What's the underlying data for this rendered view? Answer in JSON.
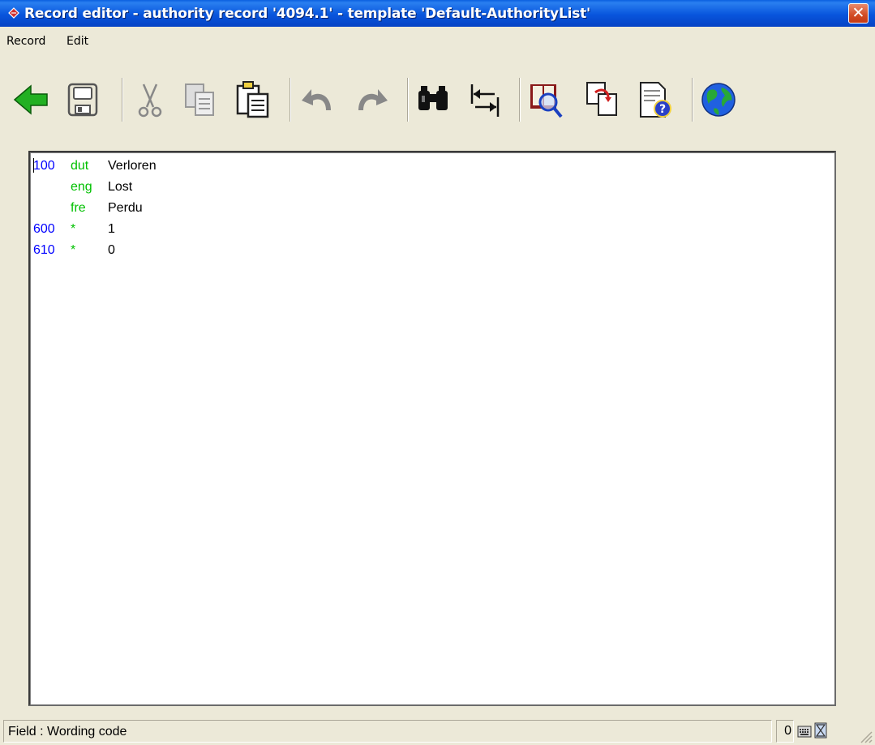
{
  "window": {
    "title": "Record editor - authority record '4094.1' - template 'Default-AuthorityList'",
    "close_glyph": "✕"
  },
  "menu": [
    {
      "label": "Record"
    },
    {
      "label": "Edit"
    }
  ],
  "toolbar": [
    {
      "icon": "back-arrow-icon"
    },
    {
      "icon": "save-disk-icon"
    },
    {
      "icon": "cut-scissors-icon"
    },
    {
      "icon": "copy-icon"
    },
    {
      "icon": "paste-icon"
    },
    {
      "icon": "undo-icon"
    },
    {
      "icon": "redo-icon"
    },
    {
      "icon": "find-binoculars-icon"
    },
    {
      "icon": "replace-arrows-icon"
    },
    {
      "icon": "book-search-icon"
    },
    {
      "icon": "copy-pages-icon"
    },
    {
      "icon": "help-document-icon"
    },
    {
      "icon": "globe-icon"
    }
  ],
  "record": {
    "rows": [
      {
        "tag": "100",
        "lang": "dut",
        "value": "Verloren"
      },
      {
        "tag": "",
        "lang": "eng",
        "value": "Lost"
      },
      {
        "tag": "",
        "lang": "fre",
        "value": "Perdu"
      },
      {
        "tag": "600",
        "lang": "*",
        "value": "1"
      },
      {
        "tag": "610",
        "lang": "*",
        "value": "0"
      }
    ]
  },
  "status": {
    "field_text": "Field : Wording code",
    "count": "0"
  },
  "colors": {
    "tag": "#0000ff",
    "lang": "#00c000",
    "titlebar": "#0855dd"
  }
}
